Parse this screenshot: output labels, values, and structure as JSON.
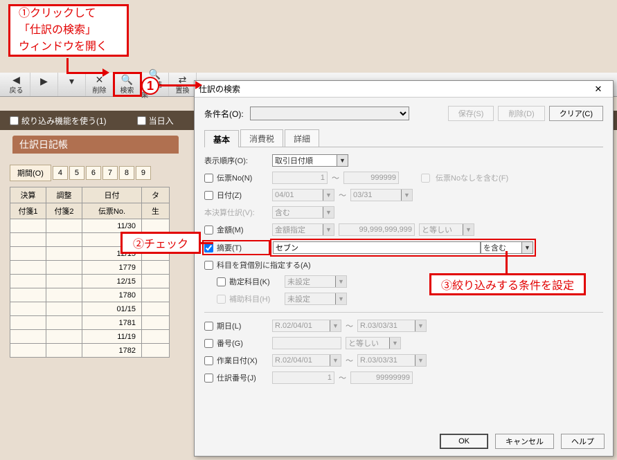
{
  "callouts": {
    "c1_line1": "①クリックして",
    "c1_line2": "「仕訳の検索」",
    "c1_line3": "ウィンドウを開く",
    "c2": "②チェック",
    "c3": "③絞り込みする条件を設定",
    "big_num": "1"
  },
  "toolbar": {
    "back": "戻る",
    "delete": "削除",
    "search": "検索",
    "search_res": "検索結果",
    "replace": "置換"
  },
  "filterbar": {
    "use_filter": "絞り込み機能を使う(1)",
    "today": "当日入"
  },
  "journal": {
    "title": "仕訳日記帳",
    "period_label": "期間(O)",
    "period_tabs": [
      "4",
      "5",
      "6",
      "7",
      "8",
      "9"
    ],
    "headers_row1": [
      "決算",
      "調整",
      "日付",
      "タ"
    ],
    "headers_row2": [
      "付箋1",
      "付箋2",
      "伝票No.",
      "生"
    ],
    "rows": [
      {
        "c3": "11/30"
      },
      {
        "c3": ""
      },
      {
        "c3": "12/15"
      },
      {
        "c3": "1779"
      },
      {
        "c3": "12/15"
      },
      {
        "c3": "1780"
      },
      {
        "c3": "01/15"
      },
      {
        "c3": "1781"
      },
      {
        "c3": "11/19"
      },
      {
        "c3": "1782"
      }
    ]
  },
  "dialog": {
    "title": "仕訳の検索",
    "cond_label": "条件名(O):",
    "save_btn": "保存(S)",
    "delete_btn": "削除(D)",
    "clear_btn": "クリア(C)",
    "tabs": {
      "basic": "基本",
      "tax": "消費税",
      "detail": "詳細"
    },
    "display_order_label": "表示順序(O):",
    "display_order_value": "取引日付順",
    "denpyo_no_label": "伝票No(N)",
    "denpyo_no_from": "1",
    "denpyo_no_to": "999999",
    "include_no_denpyo": "伝票Noなしを含む(F)",
    "date_label": "日付(Z)",
    "date_from": "04/01",
    "date_to": "03/31",
    "honkessan_label": "本決算仕訳(V):",
    "honkessan_value": "含む",
    "amount_label": "金額(M)",
    "amount_type": "金額指定",
    "amount_value": "99,999,999,999",
    "amount_cond": "と等しい",
    "tekiyo_label": "摘要(T)",
    "tekiyo_value": "セブン",
    "tekiyo_cond": "を含む",
    "kamoku_by_debit": "科目を貸借別に指定する(A)",
    "kanjo_label": "勘定科目(K)",
    "kanjo_value": "未設定",
    "hojo_label": "補助科目(H)",
    "hojo_value": "未設定",
    "kijitsu_label": "期日(L)",
    "kijitsu_from": "R.02/04/01",
    "kijitsu_to": "R.03/03/31",
    "bango_label": "番号(G)",
    "bango_cond": "と等しい",
    "sagyo_date_label": "作業日付(X)",
    "sagyo_date_from": "R.02/04/01",
    "sagyo_date_to": "R.03/03/31",
    "shiwake_no_label": "仕訳番号(J)",
    "shiwake_no_from": "1",
    "shiwake_no_to": "99999999",
    "ok_btn": "OK",
    "cancel_btn": "キャンセル",
    "help_btn": "ヘルプ"
  }
}
